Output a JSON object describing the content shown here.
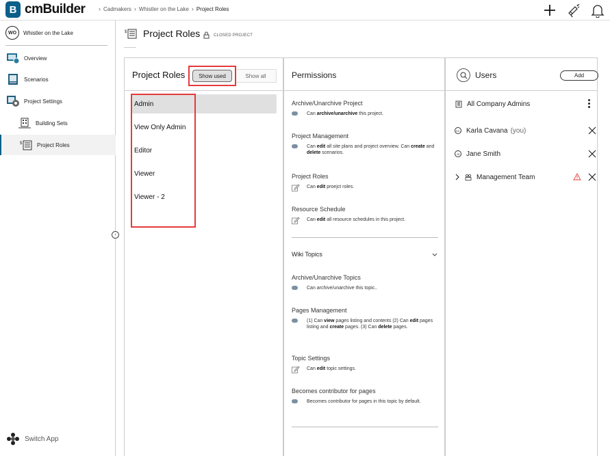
{
  "app": {
    "logo_letter": "B",
    "name": "cmBuilder"
  },
  "breadcrumb": [
    "Cadmakers",
    "Whistler on the Lake",
    "Project Roles"
  ],
  "sidebar": {
    "project_badge": "WO",
    "project_name": "Whistler on the Lake",
    "items": [
      {
        "label": "Overview",
        "icon": "overview-icon"
      },
      {
        "label": "Scenarios",
        "icon": "scenarios-icon"
      },
      {
        "label": "Project Settings",
        "icon": "project-settings-icon"
      },
      {
        "label": "Building Sets",
        "icon": "building-sets-icon"
      },
      {
        "label": "Project Roles",
        "icon": "project-roles-icon"
      }
    ],
    "switch_app": "Switch App"
  },
  "page": {
    "title": "Project Roles",
    "status": "CLOSED PROJECT"
  },
  "roles_panel": {
    "title": "Project Roles",
    "show_used": "Show used",
    "show_all": "Show all",
    "roles": [
      "Admin",
      "View Only Admin",
      "Editor",
      "Viewer",
      "Viewer - 2"
    ],
    "selected": "Admin"
  },
  "permissions": {
    "title": "Permissions",
    "archive_title": "Archive/Unarchive Project",
    "archive_a": "Can ",
    "archive_b": "archive/unarchive",
    "archive_c": " this project.",
    "pm_title": "Project Management",
    "pm_a": "Can ",
    "pm_b": "edit",
    "pm_c": " all site plans and project overview. Can ",
    "pm_d": "create",
    "pm_e": " and ",
    "pm_f": "delete",
    "pm_g": " scenarios.",
    "roles_title": "Project Roles",
    "roles_a": "Can ",
    "roles_b": "edit",
    "roles_c": " proejct roles.",
    "rs_title": "Resource Schedule",
    "rs_a": "Can ",
    "rs_b": "edit",
    "rs_c": " all resource schedules in this project.",
    "wiki_title": "Wiki Topics",
    "wt_archive_title": "Archive/Unarchive Topics",
    "wt_archive_text": "Can archive/unarchive this topic..",
    "pages_title": "Pages Management",
    "pages_a": "(1) Can ",
    "pages_b": "view",
    "pages_c": " pages listing and contents (2) Can ",
    "pages_d": "edit",
    "pages_e": " pages listing and ",
    "pages_f": "create",
    "pages_g": " pages. (3) Can ",
    "pages_h": "delete",
    "pages_i": " pages.",
    "ts_title": "Topic Settings",
    "ts_a": "Can ",
    "ts_b": "edit",
    "ts_c": " topic settings.",
    "bc_title": "Becomes contributor for pages",
    "bc_text": "Becomes contributor for pages in this topic by default."
  },
  "users": {
    "title": "Users",
    "add": "Add",
    "rows": [
      {
        "name": "All Company Admins",
        "badge": ""
      },
      {
        "name": "Karla Cavana",
        "suffix": "(you)",
        "badge": "KC"
      },
      {
        "name": "Jane Smith",
        "badge": "JS"
      },
      {
        "name": "Management Team",
        "badge": ""
      }
    ]
  },
  "colors": {
    "brand": "#0b5f8a",
    "highlight": "#e53a3a",
    "warning": "#e53a3a"
  }
}
